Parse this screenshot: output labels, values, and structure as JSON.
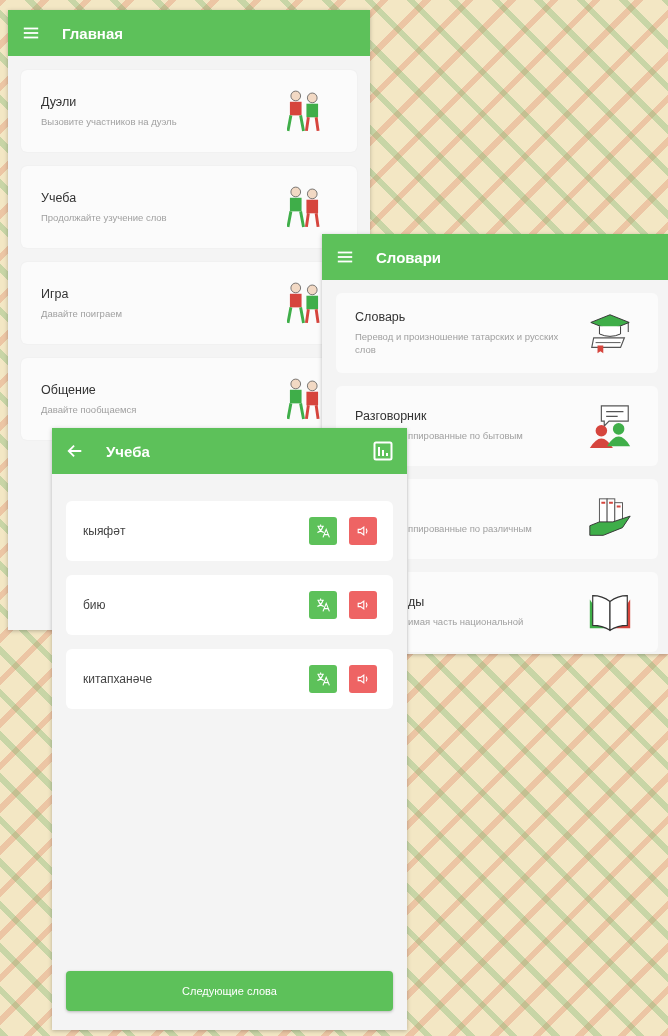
{
  "main_screen": {
    "title": "Главная",
    "cards": [
      {
        "title": "Дуэли",
        "subtitle": "Вызовите участников на дуэль"
      },
      {
        "title": "Учеба",
        "subtitle": "Продолжайте узучение слов"
      },
      {
        "title": "Игра",
        "subtitle": "Давайте поиграем"
      },
      {
        "title": "Общение",
        "subtitle": "Давайте пообщаемся"
      }
    ]
  },
  "dictionaries_screen": {
    "title": "Словари",
    "cards": [
      {
        "title": {
          "text": "Словарь",
          "cut": false
        },
        "subtitle": {
          "text": "Перевод и произношение татарских и русских слов",
          "cut": false
        }
      },
      {
        "title": {
          "text": "Разговорник",
          "cut": false
        },
        "subtitle": {
          "text": "ппированные по бытовым",
          "cut": true
        }
      },
      {
        "subtitle": {
          "text": "ппированные по различным",
          "cut": true
        }
      },
      {
        "title": {
          "text": "ды",
          "cut": true
        },
        "subtitle": {
          "text": "имая часть национальной",
          "cut": true
        }
      }
    ]
  },
  "study_screen": {
    "title": "Учеба",
    "words": [
      "кыяфәт",
      "бию",
      "китапханәче"
    ],
    "next_button": "Следующие слова"
  }
}
